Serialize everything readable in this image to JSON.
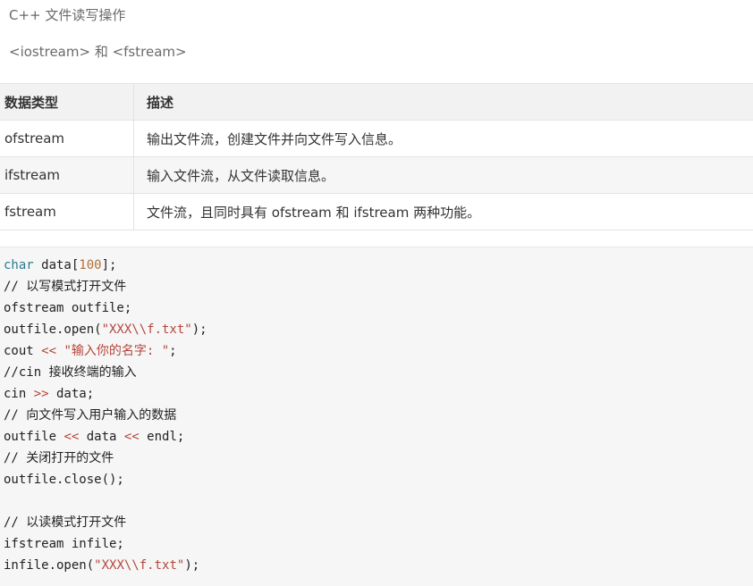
{
  "page": {
    "title": "C++ 文件读写操作",
    "headers": "<iostream> 和 <fstream>"
  },
  "table": {
    "columns": [
      "数据类型",
      "描述"
    ],
    "rows": [
      [
        "ofstream",
        "输出文件流，创建文件并向文件写入信息。"
      ],
      [
        "ifstream",
        "输入文件流，从文件读取信息。"
      ],
      [
        "fstream",
        "文件流，且同时具有 ofstream 和 ifstream 两种功能。"
      ]
    ]
  },
  "code": {
    "l1": {
      "kw": "char",
      "rest": " data[",
      "num": "100",
      "end": "];"
    },
    "l2": "// 以写模式打开文件",
    "l3": "ofstream outfile;",
    "l4": {
      "pre": "outfile.open(",
      "str": "\"XXX\\\\f.txt\"",
      "end": ");"
    },
    "l5": {
      "pre": "cout ",
      "op": "<<",
      "mid": " ",
      "str": "\"输入你的名字: \"",
      "end": ";"
    },
    "l6": "//cin 接收终端的输入",
    "l7": {
      "pre": "cin ",
      "op": ">>",
      "end": " data;"
    },
    "l8": "// 向文件写入用户输入的数据",
    "l9": {
      "pre": "outfile ",
      "op1": "<<",
      "mid": " data ",
      "op2": "<<",
      "end": " endl;"
    },
    "l10": "// 关闭打开的文件",
    "l11": "outfile.close();",
    "l12": "// 以读模式打开文件",
    "l13": "ifstream infile;",
    "l14": {
      "pre": "infile.open(",
      "str": "\"XXX\\\\f.txt\"",
      "end": ");"
    }
  }
}
